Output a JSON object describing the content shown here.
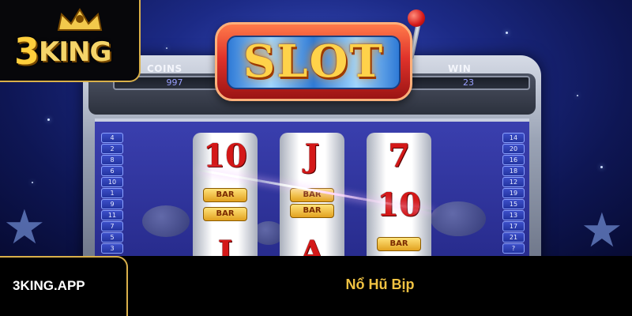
{
  "brand": {
    "logo_text_number": "3",
    "logo_text_word": "KING",
    "site": "3KING.APP"
  },
  "article": {
    "title": "Nổ Hũ Bịp"
  },
  "machine": {
    "sign": "SLOT",
    "coins_label": "COINS",
    "coins_value": "997",
    "win_label": "WIN",
    "win_value": "23",
    "left_paylines": [
      "4",
      "2",
      "8",
      "6",
      "10",
      "1",
      "9",
      "11",
      "7",
      "5",
      "3"
    ],
    "right_paylines": [
      "14",
      "20",
      "16",
      "18",
      "12",
      "19",
      "15",
      "13",
      "17",
      "21",
      "?"
    ],
    "reels": [
      {
        "top": "10",
        "mid1": "BAR",
        "mid2": "BAR",
        "bottom": "J"
      },
      {
        "top": "J",
        "mid1": "BAR",
        "mid2": "BAR",
        "bottom": "A"
      },
      {
        "top": "7",
        "mid1": "10",
        "mid2": "BAR",
        "bottom": ""
      }
    ]
  },
  "colors": {
    "accent_gold": "#d9b04a",
    "title_gold": "#f0c242",
    "reel_red": "#d41818"
  },
  "icons": {
    "lever": "slot-lever-icon",
    "crown": "crown-icon"
  }
}
